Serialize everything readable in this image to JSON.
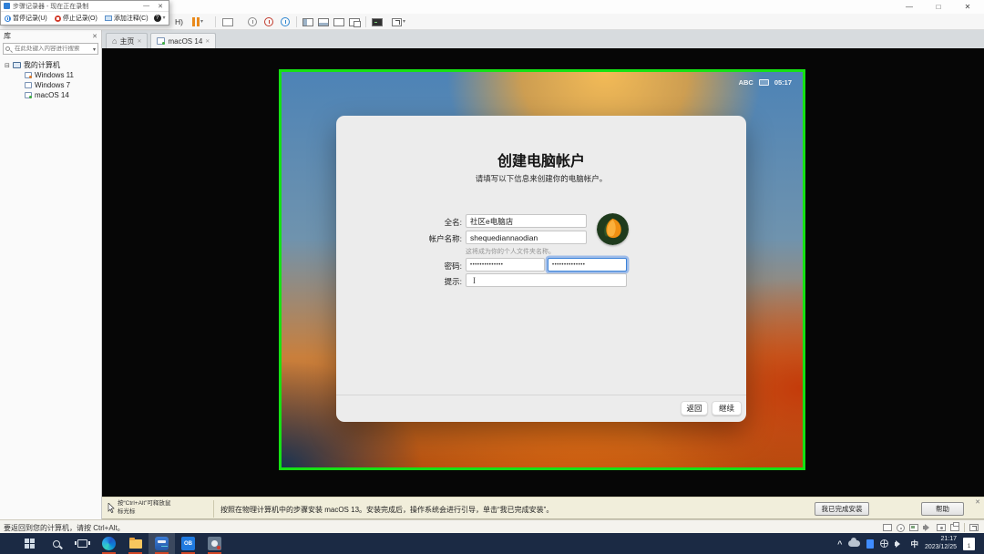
{
  "icons": {
    "minimize": "—",
    "maximize": "□",
    "close": "✕",
    "chevron_down": "▾",
    "home": "⌂",
    "collapse_box": "⊟",
    "help": "?",
    "ibeam": "I"
  },
  "steps_recorder": {
    "title": "步骤记录器 - 现在正在录制",
    "buttons": {
      "pause": "暂停记录(U)",
      "stop": "停止记录(O)",
      "annotate": "添加注释(C)"
    }
  },
  "vmware": {
    "menu_partial": "H)",
    "tabs": [
      {
        "label": "主页"
      },
      {
        "label": "macOS 14"
      }
    ],
    "library": {
      "title": "库",
      "search_placeholder": "在此处键入内容进行搜索",
      "tree_root": "我的计算机",
      "vms": [
        "Windows 11",
        "Windows 7",
        "macOS 14"
      ]
    },
    "message_bar": {
      "release_hint": "按“Ctrl+Alt”可释放鼠标光标",
      "message": "按照在物理计算机中的步骤安装 macOS 13。安装完成后，操作系统会进行引导，单击“我已完成安装”。",
      "done_button": "我已完成安装",
      "help_button": "帮助"
    },
    "status_bar": "要返回到您的计算机，请按 Ctrl+Alt。"
  },
  "macos": {
    "menubar": {
      "input_method": "ABC",
      "time": "05:17"
    },
    "dialog": {
      "title": "创建电脑帐户",
      "subtitle": "请填写以下信息来创建你的电脑帐户。",
      "full_name_label": "全名:",
      "full_name_value": "社区e电脑店",
      "account_label": "帐户名称:",
      "account_value": "shequediannaodian",
      "account_hint": "这将成为你的个人文件夹名称。",
      "password_label": "密码:",
      "password_value": "••••••••••••••",
      "password_verify_value": "••••••••••••••",
      "hint_label": "提示:",
      "hint_value": "",
      "back_button": "返回",
      "continue_button": "继续"
    }
  },
  "taskbar": {
    "ob_label": "OB",
    "ime": "中",
    "time": "21:17",
    "date": "2023/12/25",
    "notification_badge": "1"
  }
}
